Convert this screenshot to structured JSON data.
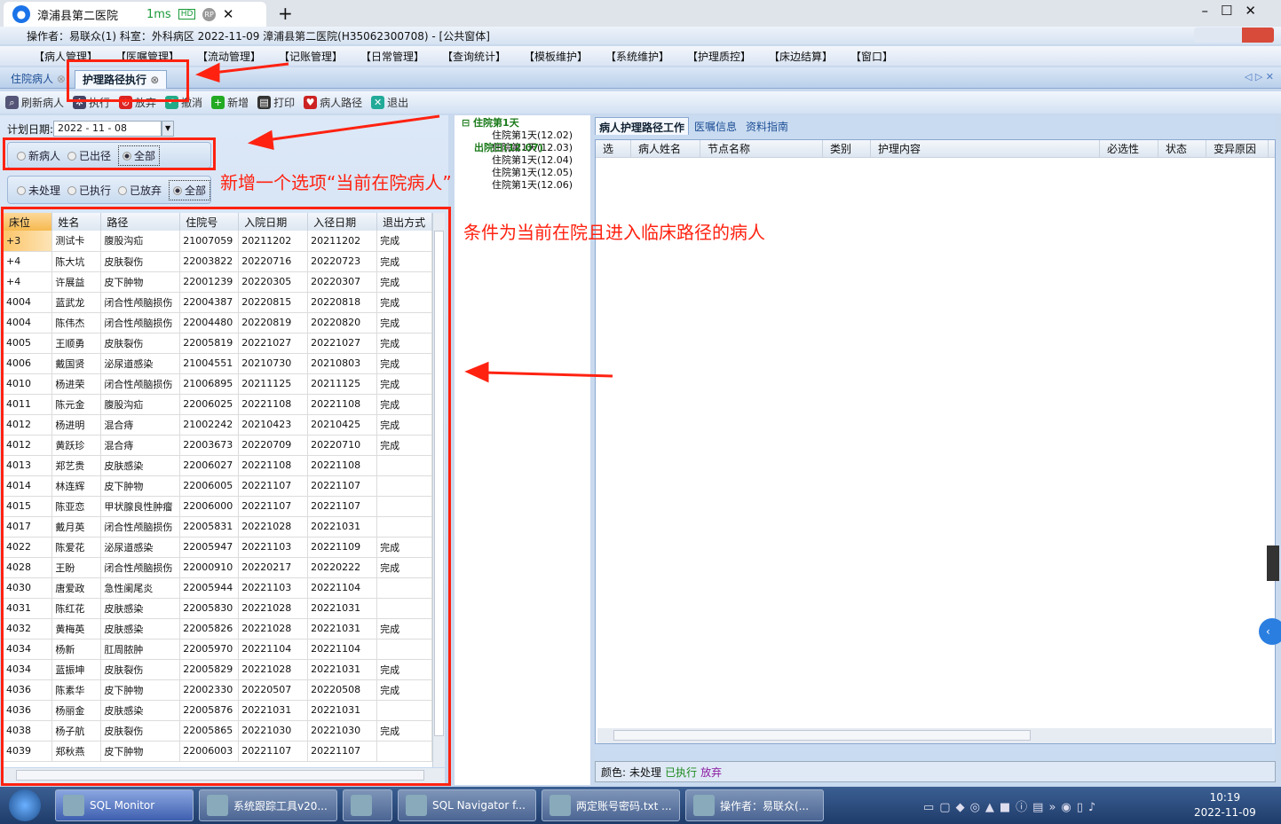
{
  "browser": {
    "tab_title": "漳浦县第二医院",
    "latency": "1ms",
    "hd": "HD",
    "rp": "RP",
    "close": "✕",
    "new_tab": "+"
  },
  "window": {
    "title": "操作者：易联众(1)  科室：外科病区  2022-11-09  漳浦县第二医院(H35062300708) - [公共窗体]"
  },
  "menu": [
    "【病人管理】",
    "【医嘱管理】",
    "【流动管理】",
    "【记账管理】",
    "【日常管理】",
    "【查询统计】",
    "【模板维护】",
    "【系统维护】",
    "【护理质控】",
    "【床边结算】",
    "【窗口】"
  ],
  "tabs": [
    {
      "label": "住院病人"
    },
    {
      "label": "护理路径执行"
    }
  ],
  "toolbar": [
    {
      "label": "刷新病人",
      "icon": "search-icon"
    },
    {
      "label": "执行",
      "icon": "gear-icon"
    },
    {
      "label": "放弃",
      "icon": "forbid-icon"
    },
    {
      "label": "撤消",
      "icon": "undo-icon"
    },
    {
      "label": "新增",
      "icon": "add-icon"
    },
    {
      "label": "打印",
      "icon": "print-icon"
    },
    {
      "label": "病人路径",
      "icon": "patient-path-icon"
    },
    {
      "label": "退出",
      "icon": "exit-icon"
    }
  ],
  "filter": {
    "date_label": "计划日期:",
    "date_value": "2022 - 11 - 08",
    "patient_options": [
      "新病人",
      "已出径",
      "全部"
    ],
    "patient_selected": "全部",
    "status_options": [
      "未处理",
      "已执行",
      "已放弃",
      "全部"
    ],
    "status_selected": "全部"
  },
  "grid": {
    "columns": [
      "床位",
      "姓名",
      "路径",
      "住院号",
      "入院日期",
      "入径日期",
      "退出方式"
    ],
    "rows": [
      [
        "+3",
        "测试卡",
        "腹股沟疝",
        "21007059",
        "20211202",
        "20211202",
        "完成"
      ],
      [
        "+4",
        "陈大坑",
        "皮肤裂伤",
        "22003822",
        "20220716",
        "20220723",
        "完成"
      ],
      [
        "+4",
        "许展益",
        "皮下肿物",
        "22001239",
        "20220305",
        "20220307",
        "完成"
      ],
      [
        "4004",
        "蓝武龙",
        "闭合性颅脑损伤",
        "22004387",
        "20220815",
        "20220818",
        "完成"
      ],
      [
        "4004",
        "陈伟杰",
        "闭合性颅脑损伤",
        "22004480",
        "20220819",
        "20220820",
        "完成"
      ],
      [
        "4005",
        "王顺勇",
        "皮肤裂伤",
        "22005819",
        "20221027",
        "20221027",
        "完成"
      ],
      [
        "4006",
        "戴国贤",
        "泌尿道感染",
        "21004551",
        "20210730",
        "20210803",
        "完成"
      ],
      [
        "4010",
        "杨进荣",
        "闭合性颅脑损伤",
        "21006895",
        "20211125",
        "20211125",
        "完成"
      ],
      [
        "4011",
        "陈元金",
        "腹股沟疝",
        "22006025",
        "20221108",
        "20221108",
        "完成"
      ],
      [
        "4012",
        "杨进明",
        "混合痔",
        "21002242",
        "20210423",
        "20210425",
        "完成"
      ],
      [
        "4012",
        "黄跃珍",
        "混合痔",
        "22003673",
        "20220709",
        "20220710",
        "完成"
      ],
      [
        "4013",
        "郑艺贵",
        "皮肤感染",
        "22006027",
        "20221108",
        "20221108",
        ""
      ],
      [
        "4014",
        "林连辉",
        "皮下肿物",
        "22006005",
        "20221107",
        "20221107",
        ""
      ],
      [
        "4015",
        "陈亚恋",
        "甲状腺良性肿瘤",
        "22006000",
        "20221107",
        "20221107",
        ""
      ],
      [
        "4017",
        "戴月英",
        "闭合性颅脑损伤",
        "22005831",
        "20221028",
        "20221031",
        ""
      ],
      [
        "4022",
        "陈爱花",
        "泌尿道感染",
        "22005947",
        "20221103",
        "20221109",
        "完成"
      ],
      [
        "4028",
        "王盼",
        "闭合性颅脑损伤",
        "22000910",
        "20220217",
        "20220222",
        "完成"
      ],
      [
        "4030",
        "唐爱政",
        "急性阑尾炎",
        "22005944",
        "20221103",
        "20221104",
        ""
      ],
      [
        "4031",
        "陈红花",
        "皮肤感染",
        "22005830",
        "20221028",
        "20221031",
        ""
      ],
      [
        "4032",
        "黄梅英",
        "皮肤感染",
        "22005826",
        "20221028",
        "20221031",
        "完成"
      ],
      [
        "4034",
        "杨新",
        "肛周脓肿",
        "22005970",
        "20221104",
        "20221104",
        ""
      ],
      [
        "4034",
        "蓝振坤",
        "皮肤裂伤",
        "22005829",
        "20221028",
        "20221031",
        "完成"
      ],
      [
        "4036",
        "陈素华",
        "皮下肿物",
        "22002330",
        "20220507",
        "20220508",
        "完成"
      ],
      [
        "4036",
        "杨丽金",
        "皮肤感染",
        "22005876",
        "20221031",
        "20221031",
        ""
      ],
      [
        "4038",
        "杨子航",
        "皮肤裂伤",
        "22005865",
        "20221030",
        "20221030",
        "完成"
      ],
      [
        "4039",
        "郑秋燕",
        "皮下肿物",
        "22006003",
        "20221107",
        "20221107",
        ""
      ]
    ]
  },
  "tree": {
    "root": "住院第1天",
    "children": [
      "住院第1天(12.02)",
      "住院第1天(12.03)",
      "住院第1天(12.04)",
      "住院第1天(12.05)",
      "住院第1天(12.06)"
    ],
    "last": "出院日(12.07)"
  },
  "right": {
    "tabs": [
      "病人护理路径工作",
      "医嘱信息",
      "资料指南"
    ],
    "columns": [
      "选",
      "病人姓名",
      "节点名称",
      "类别",
      "护理内容",
      "必选性",
      "状态",
      "变异原因"
    ],
    "legend_label": "颜色:",
    "legend": [
      {
        "text": "未处理",
        "color": "#111111"
      },
      {
        "text": "已执行",
        "color": "#1a8a1a"
      },
      {
        "text": "放弃",
        "color": "#8a1aa0"
      }
    ]
  },
  "annotations": {
    "note1": "新增一个选项“当前在院病人”",
    "note2": "条件为当前在院且进入临床路径的病人"
  },
  "taskbar": {
    "items": [
      "SQL Monitor",
      "系统跟踪工具v20...",
      "",
      "SQL Navigator f...",
      "两定账号密码.txt ...",
      "操作者：易联众(..."
    ],
    "time": "10:19",
    "date": "2022-11-09"
  }
}
